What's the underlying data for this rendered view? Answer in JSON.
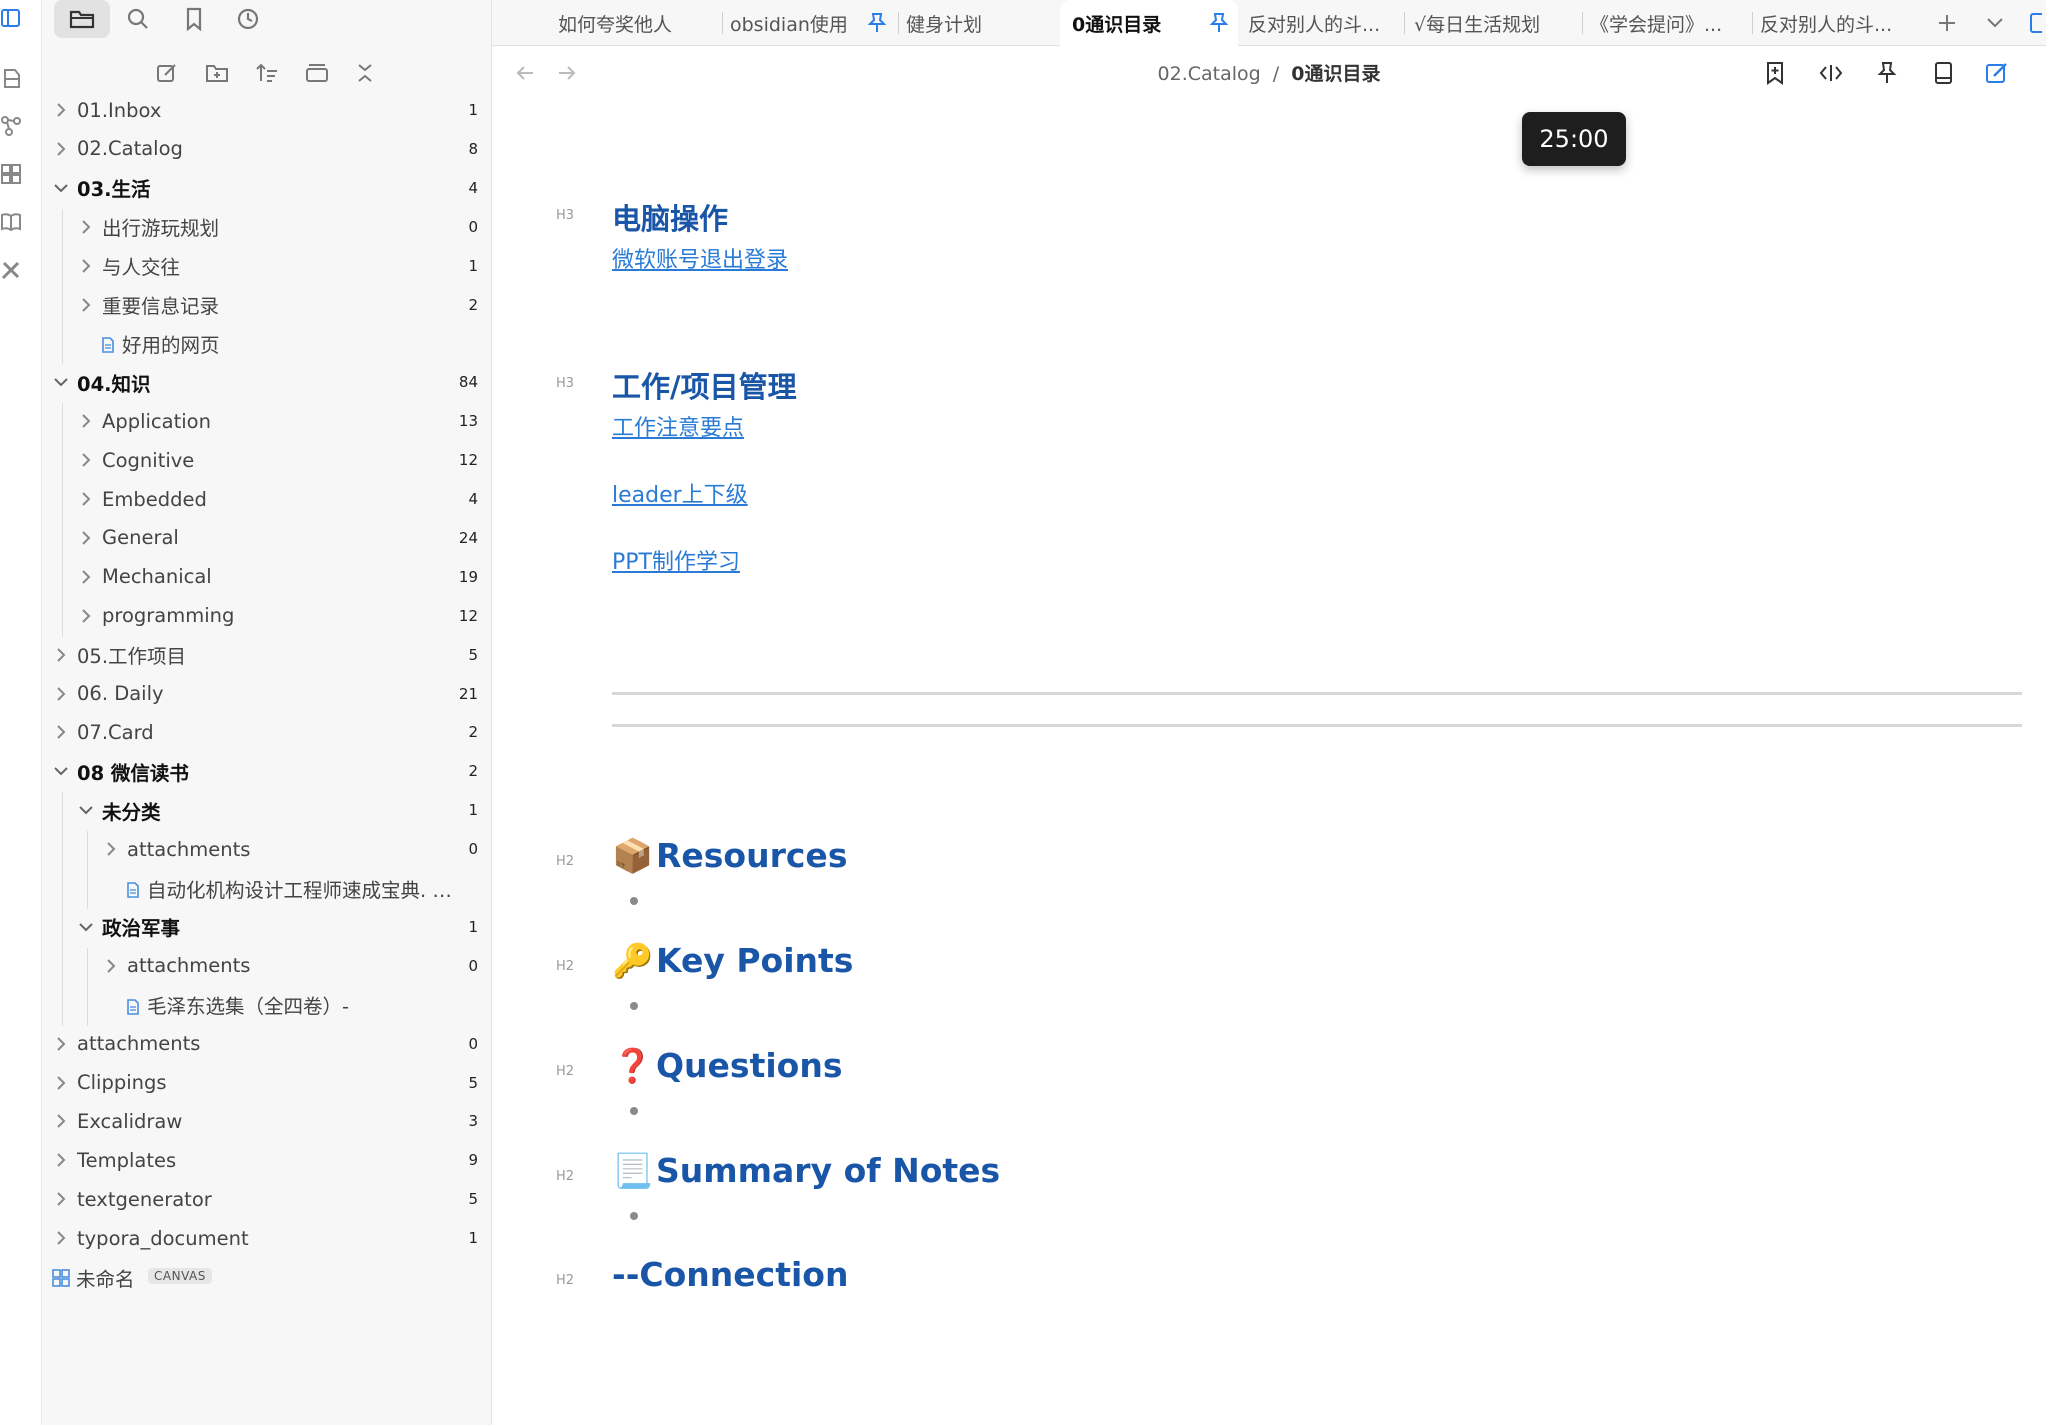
{
  "tabs": [
    {
      "label": "如何夸奖他人",
      "pinned": false,
      "active": false
    },
    {
      "label": "obsidian使用",
      "pinned": true,
      "active": false
    },
    {
      "label": "健身计划",
      "pinned": false,
      "active": false
    },
    {
      "label": "0通识目录",
      "pinned": true,
      "active": true
    },
    {
      "label": "反对别人的斗...",
      "pinned": false,
      "active": false
    },
    {
      "label": "√每日生活规划",
      "pinned": false,
      "active": false
    },
    {
      "label": "《学会提问》...",
      "pinned": false,
      "active": false
    },
    {
      "label": "反对别人的斗...",
      "pinned": false,
      "active": false
    }
  ],
  "breadcrumb": {
    "folder": "02.Catalog",
    "separator": "/",
    "file": "0通识目录"
  },
  "timer": {
    "value": "25:00"
  },
  "tree": [
    {
      "label": "01.Inbox",
      "count": "1",
      "depth": 0,
      "type": "folder",
      "open": false
    },
    {
      "label": "02.Catalog",
      "count": "8",
      "depth": 0,
      "type": "folder",
      "open": false
    },
    {
      "label": "03.生活",
      "count": "4",
      "depth": 0,
      "type": "folder",
      "open": true
    },
    {
      "label": "出行游玩规划",
      "count": "0",
      "depth": 1,
      "type": "folder",
      "open": false
    },
    {
      "label": "与人交往",
      "count": "1",
      "depth": 1,
      "type": "folder",
      "open": false
    },
    {
      "label": "重要信息记录",
      "count": "2",
      "depth": 1,
      "type": "folder",
      "open": false
    },
    {
      "label": "好用的网页",
      "count": "",
      "depth": 1,
      "type": "file",
      "open": false
    },
    {
      "label": "04.知识",
      "count": "84",
      "depth": 0,
      "type": "folder",
      "open": true
    },
    {
      "label": "Application",
      "count": "13",
      "depth": 1,
      "type": "folder",
      "open": false
    },
    {
      "label": "Cognitive",
      "count": "12",
      "depth": 1,
      "type": "folder",
      "open": false
    },
    {
      "label": "Embedded",
      "count": "4",
      "depth": 1,
      "type": "folder",
      "open": false
    },
    {
      "label": "General",
      "count": "24",
      "depth": 1,
      "type": "folder",
      "open": false
    },
    {
      "label": "Mechanical",
      "count": "19",
      "depth": 1,
      "type": "folder",
      "open": false
    },
    {
      "label": "programming",
      "count": "12",
      "depth": 1,
      "type": "folder",
      "open": false
    },
    {
      "label": "05.工作项目",
      "count": "5",
      "depth": 0,
      "type": "folder",
      "open": false
    },
    {
      "label": "06. Daily",
      "count": "21",
      "depth": 0,
      "type": "folder",
      "open": false
    },
    {
      "label": "07.Card",
      "count": "2",
      "depth": 0,
      "type": "folder",
      "open": false
    },
    {
      "label": "08 微信读书",
      "count": "2",
      "depth": 0,
      "type": "folder",
      "open": true
    },
    {
      "label": "未分类",
      "count": "1",
      "depth": 1,
      "type": "folder",
      "open": true
    },
    {
      "label": "attachments",
      "count": "0",
      "depth": 2,
      "type": "folder",
      "open": false
    },
    {
      "label": "自动化机构设计工程师速成宝典. 实战...",
      "count": "",
      "depth": 2,
      "type": "file",
      "open": false
    },
    {
      "label": "政治军事",
      "count": "1",
      "depth": 1,
      "type": "folder",
      "open": true
    },
    {
      "label": "attachments",
      "count": "0",
      "depth": 2,
      "type": "folder",
      "open": false
    },
    {
      "label": "毛泽东选集（全四卷）-",
      "count": "",
      "depth": 2,
      "type": "file",
      "open": false
    },
    {
      "label": "attachments",
      "count": "0",
      "depth": 0,
      "type": "folder",
      "open": false
    },
    {
      "label": "Clippings",
      "count": "5",
      "depth": 0,
      "type": "folder",
      "open": false
    },
    {
      "label": "Excalidraw",
      "count": "3",
      "depth": 0,
      "type": "folder",
      "open": false
    },
    {
      "label": "Templates",
      "count": "9",
      "depth": 0,
      "type": "folder",
      "open": false
    },
    {
      "label": "textgenerator",
      "count": "5",
      "depth": 0,
      "type": "folder",
      "open": false
    },
    {
      "label": "typora_document",
      "count": "1",
      "depth": 0,
      "type": "folder",
      "open": false
    },
    {
      "label": "未命名",
      "count": "",
      "depth": 0,
      "type": "canvas",
      "open": false,
      "badge": "CANVAS"
    }
  ],
  "content": {
    "sections": [
      {
        "tag": "H3",
        "heading": "电脑操作",
        "links": [
          "微软账号退出登录"
        ]
      },
      {
        "tag": "H3",
        "heading": "工作/项目管理",
        "links": [
          "工作注意要点",
          "leader上下级",
          "PPT制作学习"
        ]
      }
    ],
    "h2": [
      {
        "tag": "H2",
        "emoji": "📦",
        "heading": "Resources",
        "bullet": true
      },
      {
        "tag": "H2",
        "emoji": "🔑",
        "heading": "Key Points",
        "bullet": true
      },
      {
        "tag": "H2",
        "emoji": "❓",
        "heading": "Questions",
        "bullet": true
      },
      {
        "tag": "H2",
        "emoji": "📃",
        "heading": "Summary of Notes",
        "bullet": true
      },
      {
        "tag": "H2",
        "emoji": "",
        "heading": "--Connection",
        "bullet": false
      }
    ]
  },
  "colors": {
    "accent": "#1a56a8",
    "link": "#2a7bd6",
    "pin": "#2b7de9",
    "timer_bg": "#1e1e1e"
  },
  "icons": {
    "ribbon": [
      "sidebar-toggle-icon",
      "files-icon",
      "graph-icon",
      "canvas-icon",
      "book-icon",
      "tools-icon"
    ],
    "sidebar_tabs": [
      "folder-icon",
      "search-icon",
      "bookmark-icon",
      "clock-icon"
    ],
    "sidebar_actions": [
      "new-note-icon",
      "new-folder-icon",
      "sort-icon",
      "collapse-icon",
      "close-all-icon"
    ],
    "view_actions": [
      "add-bookmark-icon",
      "code-view-icon",
      "pin-icon",
      "reading-view-icon",
      "edit-icon"
    ]
  }
}
